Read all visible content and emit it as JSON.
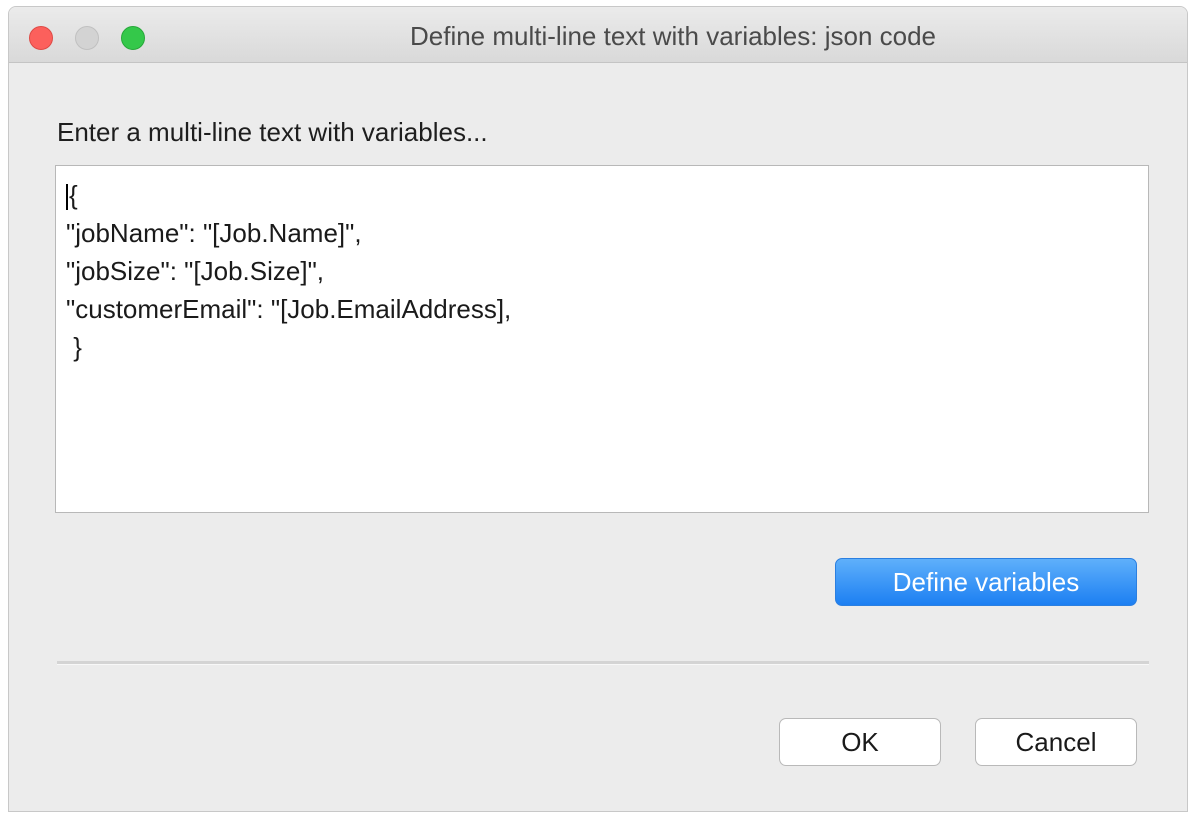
{
  "window": {
    "title": "Define multi-line text with variables: json code",
    "controls": [
      "close",
      "minimize",
      "zoom"
    ]
  },
  "prompt": {
    "label": "Enter a multi-line text with variables..."
  },
  "editor": {
    "lines": [
      "{",
      "\"jobName\": \"[Job.Name]\",",
      "\"jobSize\": \"[Job.Size]\",",
      "\"customerEmail\": \"[Job.EmailAddress],",
      " }"
    ]
  },
  "buttons": {
    "define_variables": "Define variables",
    "ok": "OK",
    "cancel": "Cancel"
  },
  "colors": {
    "accent": "#1c7ff2",
    "close": "#fc605c",
    "zoom": "#34c84a"
  }
}
